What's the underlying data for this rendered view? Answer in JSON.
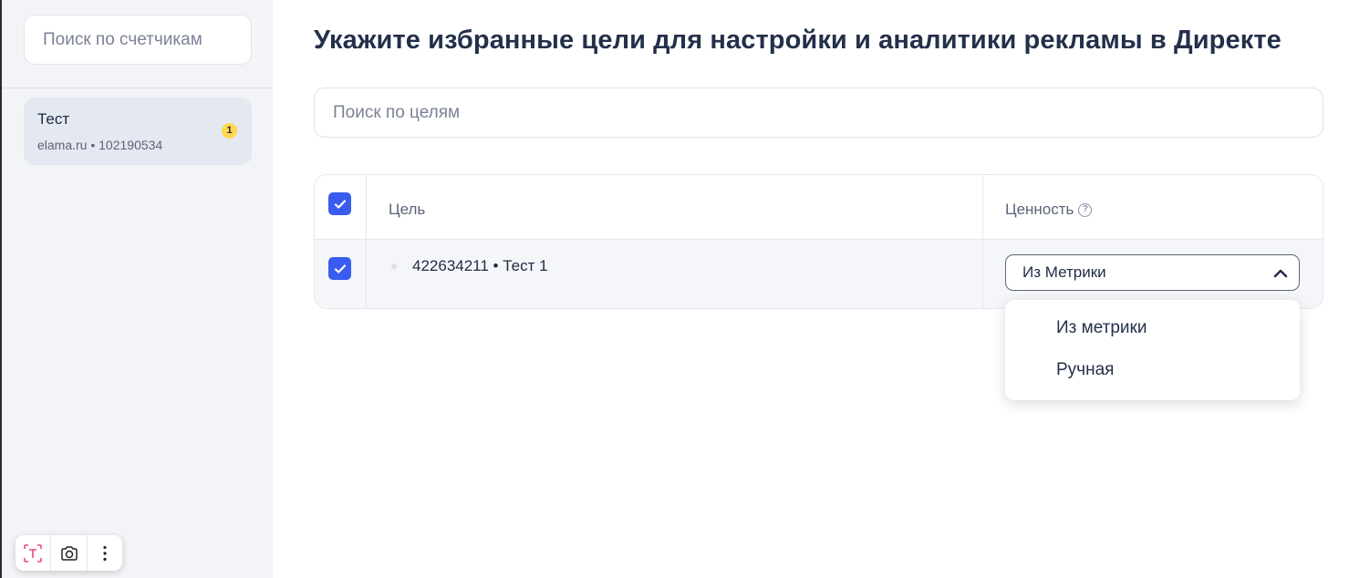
{
  "sidebar": {
    "search_placeholder": "Поиск по счетчикам",
    "counters": [
      {
        "name": "Тест",
        "subtitle": "elama.ru • 102190534",
        "badge": "1"
      }
    ]
  },
  "toolbar": {
    "icons": [
      "text-select-icon",
      "camera-icon",
      "more-vertical-icon"
    ],
    "accent": "#e8468a"
  },
  "main": {
    "title": "Укажите избранные цели для настройки и аналитики рекламы в Директе",
    "search_placeholder": "Поиск по целям",
    "table": {
      "header_goal": "Цель",
      "header_value": "Ценность",
      "select_all_checked": true,
      "rows": [
        {
          "checked": true,
          "goal": "422634211 • Тест 1",
          "value": "Из Метрики"
        }
      ]
    },
    "dropdown": {
      "open": true,
      "options": [
        "Из метрики",
        "Ручная"
      ]
    }
  },
  "colors": {
    "checkbox": "#3a5bf0",
    "badge": "#ffd84d",
    "sidebar_bg": "#f3f4f7",
    "title": "#24304a"
  }
}
